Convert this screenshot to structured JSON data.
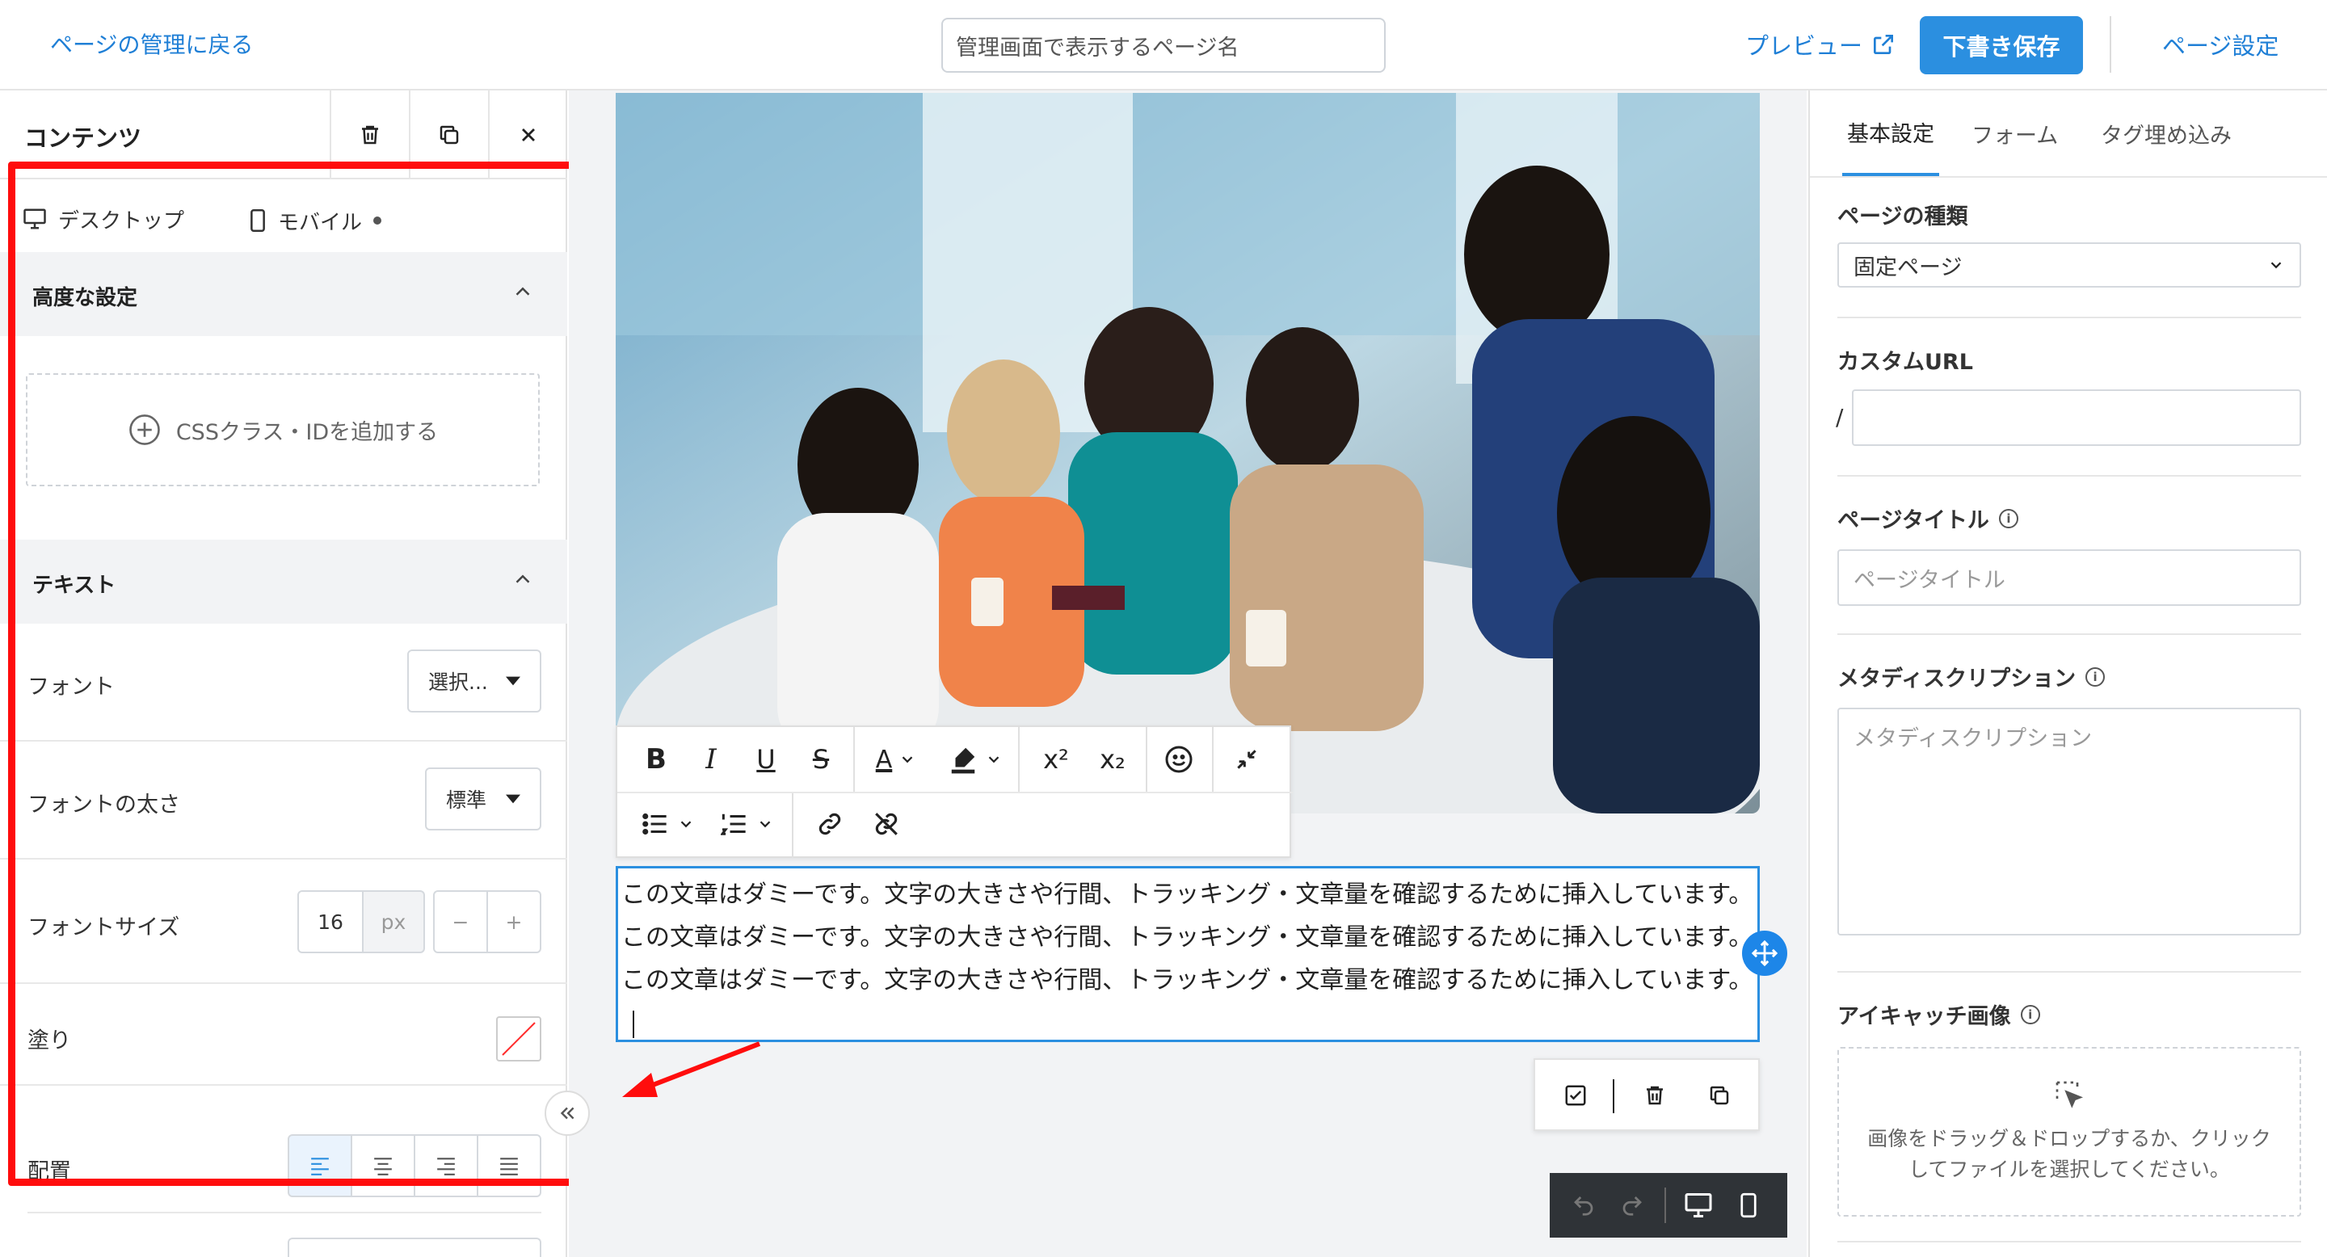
{
  "header": {
    "back_label": "ページの管理に戻る",
    "page_name_placeholder": "管理画面で表示するページ名",
    "preview_label": "プレビュー",
    "save_draft_label": "下書き保存",
    "page_settings_label": "ページ設定"
  },
  "left_panel": {
    "title": "コンテンツ",
    "tabs": [
      {
        "label": "デスクトップ",
        "active": true
      },
      {
        "label": "モバイル",
        "active": false
      }
    ],
    "advanced": {
      "title": "高度な設定",
      "add_css_label": "CSSクラス・IDを追加する"
    },
    "text": {
      "title": "テキスト",
      "font_label": "フォント",
      "font_value": "選択...",
      "weight_label": "フォントの太さ",
      "weight_value": "標準",
      "size_label": "フォントサイズ",
      "size_value": "16",
      "size_unit": "px",
      "minus": "−",
      "plus": "+",
      "fill_label": "塗り",
      "align_label": "配置"
    }
  },
  "editor": {
    "paragraph_text": "この文章はダミーです。文字の大きさや行間、トラッキング・文章量を確認するために挿入しています。この文章はダミーです。文字の大きさや行間、トラッキング・文章量を確認するために挿入しています。この文章はダミーです。文字の大きさや行間、トラッキング・文章量を確認するために挿入しています。",
    "toolbar": {
      "bold": "B",
      "italic": "I",
      "underline": "U",
      "strike": "S",
      "text_color": "A",
      "sup": "x²",
      "sub": "x₂"
    }
  },
  "right_panel": {
    "tabs": [
      {
        "label": "基本設定",
        "active": true
      },
      {
        "label": "フォーム",
        "active": false
      },
      {
        "label": "タグ埋め込み",
        "active": false
      }
    ],
    "page_type_label": "ページの種類",
    "page_type_value": "固定ページ",
    "custom_url_label": "カスタムURL",
    "url_prefix": "/",
    "page_title_label": "ページタイトル",
    "page_title_placeholder": "ページタイトル",
    "meta_label": "メタディスクリプション",
    "meta_placeholder": "メタディスクリプション",
    "eyecatch_label": "アイキャッチ画像",
    "eyecatch_hint": "画像をドラッグ＆ドロップするか、クリックしてファイルを選択してください。"
  },
  "colors": {
    "accent": "#2b8fe0",
    "annotation": "#ff0d0d"
  }
}
